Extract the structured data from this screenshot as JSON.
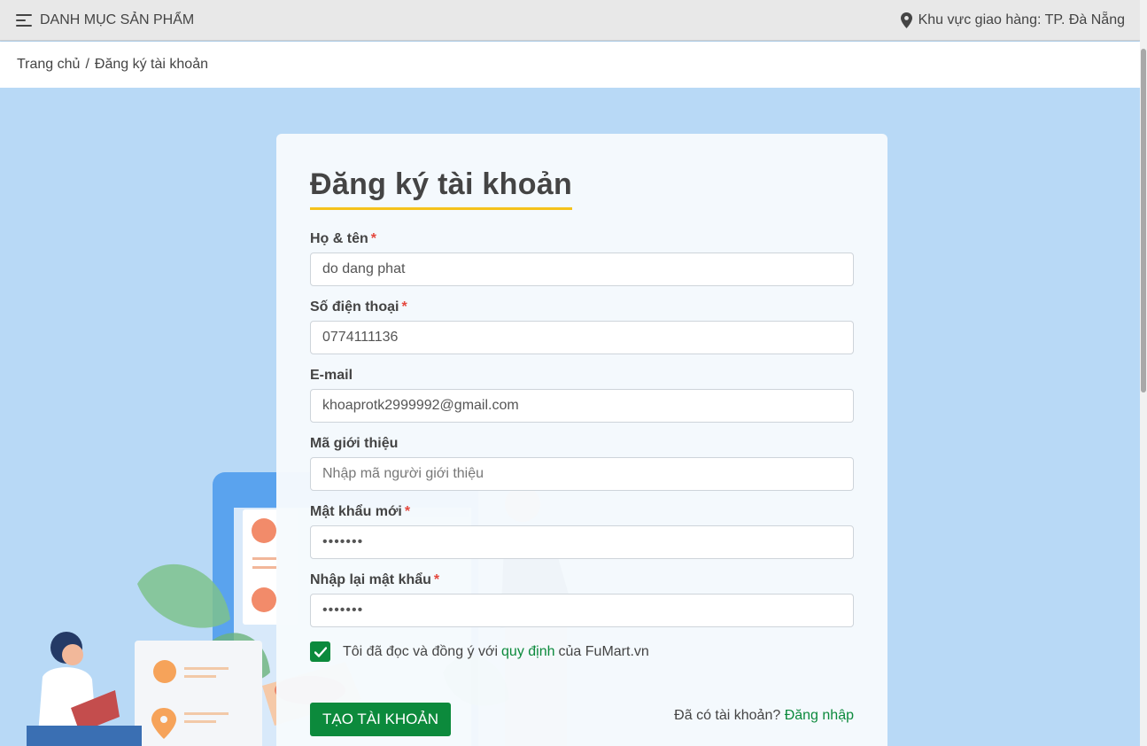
{
  "header": {
    "menu_label": "DANH MỤC SẢN PHẨM",
    "delivery_label": "Khu vực giao hàng: TP. Đà Nẵng"
  },
  "breadcrumb": {
    "home": "Trang chủ",
    "separator": "/",
    "current": "Đăng ký tài khoản"
  },
  "form": {
    "title": "Đăng ký tài khoản",
    "required_mark": "*",
    "fields": {
      "full_name": {
        "label": "Họ & tên",
        "value": "do dang phat"
      },
      "phone": {
        "label": "Số điện thoại",
        "value": "0774111136"
      },
      "email": {
        "label": "E-mail",
        "value": "khoaprotk2999992@gmail.com"
      },
      "referral": {
        "label": "Mã giới thiệu",
        "value": "",
        "placeholder": "Nhập mã người giới thiệu"
      },
      "password": {
        "label": "Mật khẩu mới",
        "value": "•••••••"
      },
      "password_confirm": {
        "label": "Nhập lại mật khẩu",
        "value": "•••••••"
      }
    },
    "agree": {
      "checked": true,
      "text_before": "Tôi đã đọc và đồng ý với",
      "link": "quy định",
      "text_after": "của FuMart.vn"
    },
    "submit_label": "TẠO TÀI KHOẢN",
    "login_prompt": "Đã có tài khoản?",
    "login_link": "Đăng nhập"
  },
  "colors": {
    "page_background": "#b8d9f6",
    "primary_green": "#0c8a3c",
    "title_underline": "#f5c21b",
    "required_red": "#e4483e"
  }
}
